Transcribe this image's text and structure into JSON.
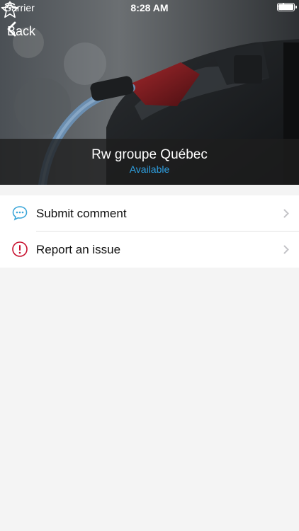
{
  "status_bar": {
    "carrier": "Carrier",
    "time": "8:28 AM"
  },
  "nav": {
    "back_label": "Back"
  },
  "station": {
    "name": "Rw groupe Québec",
    "status": "Available",
    "status_color": "#2e9fe0"
  },
  "menu": {
    "items": [
      {
        "label": "Submit comment",
        "icon": "comment-icon",
        "icon_color": "#3aa6d9"
      },
      {
        "label": "Report an issue",
        "icon": "alert-icon",
        "icon_color": "#c8102e"
      }
    ]
  }
}
